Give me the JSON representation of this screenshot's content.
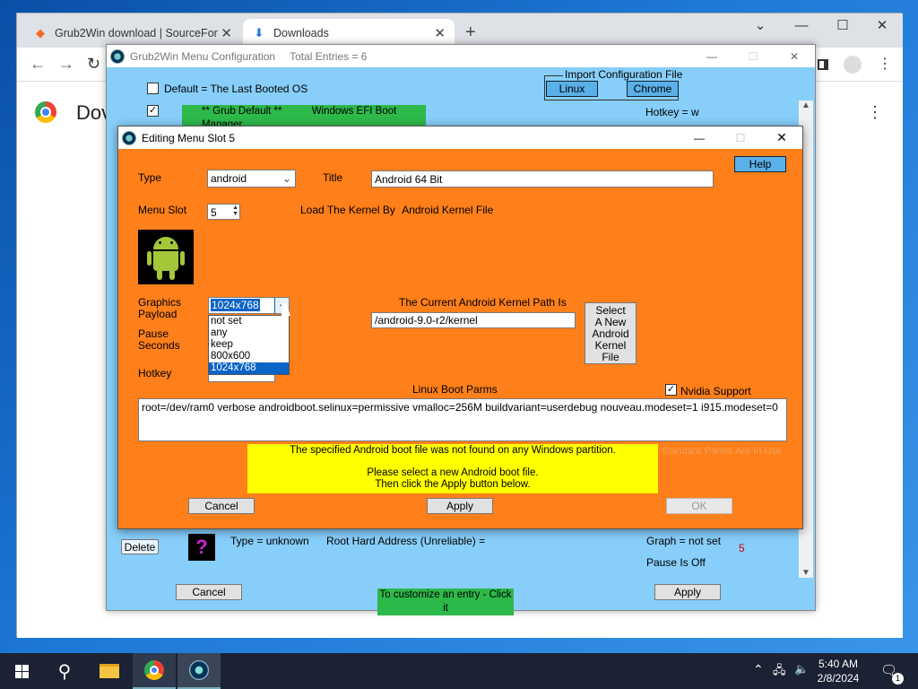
{
  "browser": {
    "tabs": [
      {
        "label": "Grub2Win download | SourceFor"
      },
      {
        "label": "Downloads"
      }
    ],
    "page_heading": "Dov",
    "new_tab": "+"
  },
  "grubwin": {
    "title": "Grub2Win Menu Configuration",
    "total_entries": "Total Entries = 6",
    "default_label": "Default = The Last Booted OS",
    "import_label": "Import Configuration File",
    "import_linux": "Linux",
    "import_chrome": "Chrome",
    "grub_default": "** Grub Default **",
    "entry_name": "Windows EFI Boot Manager",
    "hotkey_w": "Hotkey = w",
    "delete_btn": "Delete",
    "type_unknown": "Type = unknown",
    "root_hard": "Root Hard Address (Unreliable) =",
    "graph_not_set": "Graph = not set",
    "pause_off": "Pause Is Off",
    "slot_number": "5",
    "customize": "To customize an entry - Click it",
    "cancel_btn": "Cancel",
    "apply_btn": "Apply"
  },
  "editor": {
    "title": "Editing Menu Slot 5",
    "help_btn": "Help",
    "type_label": "Type",
    "type_value": "android",
    "title_label": "Title",
    "title_value": "Android 64 Bit",
    "menu_slot_label": "Menu Slot",
    "menu_slot_value": "5",
    "load_kernel_by": "Load The Kernel By",
    "load_kernel_value": "Android Kernel File",
    "graphics_label1": "Graphics",
    "graphics_label2": "Payload",
    "graphics_value": "1024x768",
    "graphics_options": [
      "not set",
      "any",
      "keep",
      "800x600",
      "1024x768"
    ],
    "pause_label1": "Pause",
    "pause_label2": "Seconds",
    "hotkey_label": "Hotkey",
    "kernel_path_label": "The Current Android Kernel Path Is",
    "kernel_path_value": "/android-9.0-r2/kernel",
    "select_btn_lines": [
      "Select",
      "A New",
      "Android",
      "Kernel",
      "File"
    ],
    "nvidia_label": "Nvidia Support",
    "boot_parms_label": "Linux Boot Parms",
    "boot_parms_value": "root=/dev/ram0 verbose androidboot.selinux=permissive vmalloc=256M buildvariant=userdebug nouveau.modeset=1 i915.modeset=0",
    "warning_line1": "The specified Android boot file was not found on any Windows partition.",
    "warning_line2": "Please select a new Android boot file.",
    "warning_line3": "Then click the Apply button below.",
    "faded_text": "Standard Parms Are In Use",
    "cancel_btn": "Cancel",
    "apply_btn": "Apply",
    "ok_btn": "OK"
  },
  "taskbar": {
    "time": "5:40 AM",
    "date": "2/8/2024",
    "notification_count": "1"
  },
  "colors": {
    "editor_bg": "#ff7f1a",
    "main_bg": "#87cefa",
    "warning_bg": "#ffff00",
    "green_label": "#2db84a",
    "selected": "#0a64c8"
  }
}
